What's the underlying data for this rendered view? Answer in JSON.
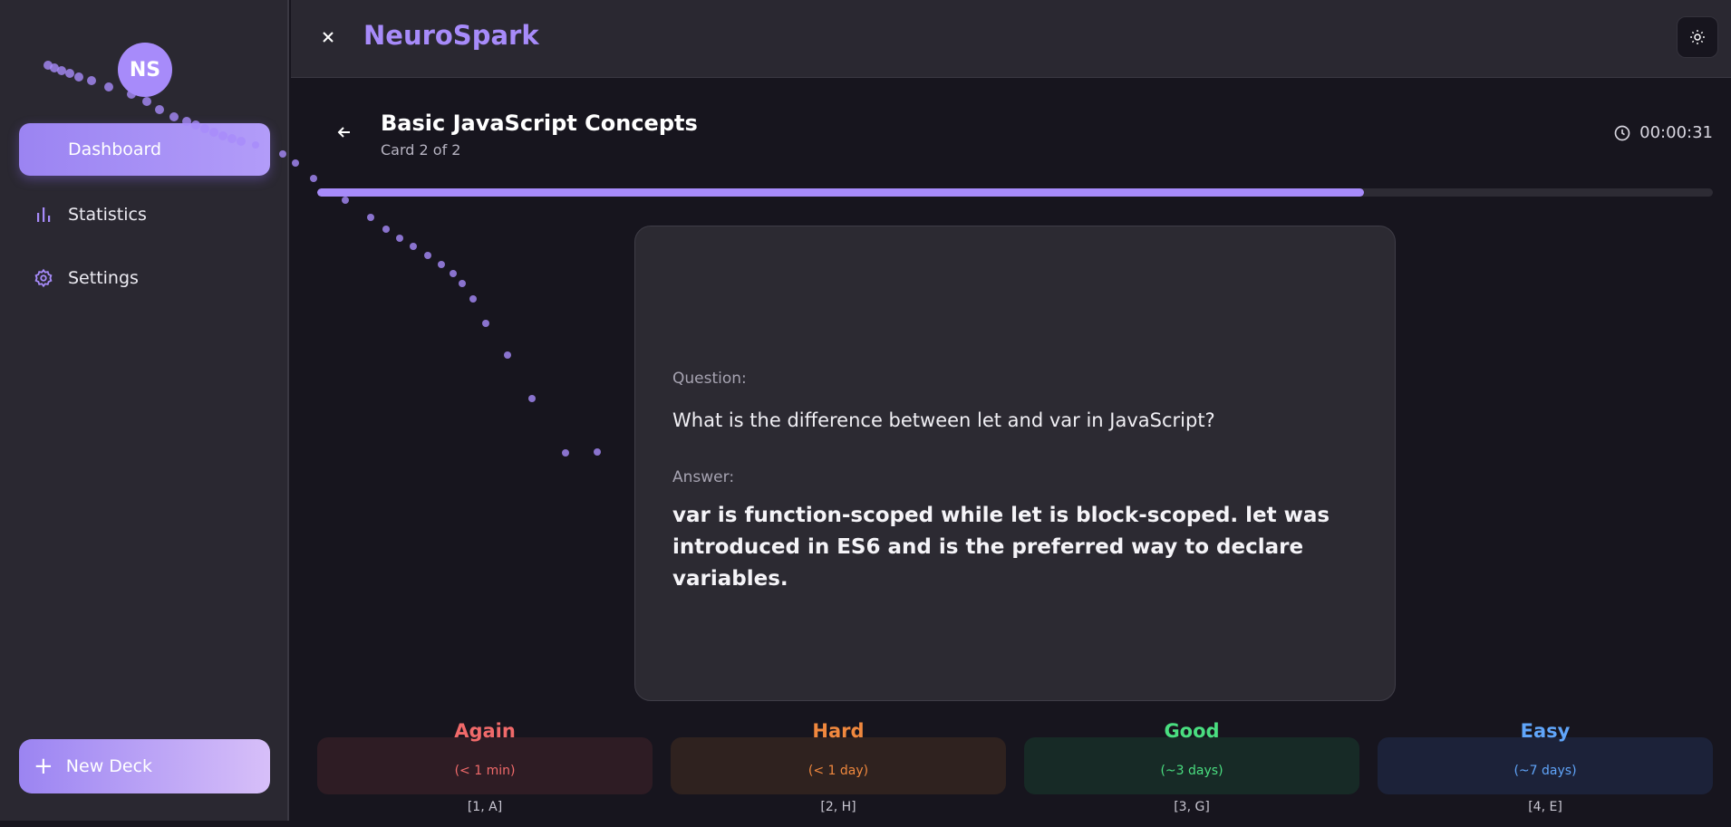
{
  "sidebar": {
    "avatar_initials": "NS",
    "items": [
      {
        "label": "Dashboard",
        "icon": "dashboard"
      },
      {
        "label": "Statistics",
        "icon": "bar-chart-icon"
      },
      {
        "label": "Settings",
        "icon": "gear-icon"
      }
    ],
    "new_deck_label": "New Deck",
    "new_deck_icon": "plus-icon"
  },
  "header": {
    "app_name": "NeuroSpark",
    "close_icon": "close-icon",
    "theme_icon": "sun-icon"
  },
  "study": {
    "deck_title": "Basic JavaScript Concepts",
    "card_position": "Card 2 of 2",
    "timer": "00:00:31",
    "progress": 0.75
  },
  "card": {
    "question_label": "Question:",
    "question": "What is the difference between let and var in JavaScript?",
    "answer_label": "Answer:",
    "answer": "var is function-scoped while let is block-scoped. let was introduced in ES6 and is the preferred way to declare variables."
  },
  "ratings": [
    {
      "label": "Again",
      "interval": "(< 1 min)",
      "keys": "[1, A]",
      "color": "#f06a6a"
    },
    {
      "label": "Hard",
      "interval": "(< 1 day)",
      "keys": "[2, H]",
      "color": "#f0883e"
    },
    {
      "label": "Good",
      "interval": "(~3 days)",
      "keys": "[3, G]",
      "color": "#4ade80"
    },
    {
      "label": "Easy",
      "interval": "(~7 days)",
      "keys": "[4, E]",
      "color": "#60a5fa"
    }
  ],
  "colors": {
    "accent": "#a78bfa",
    "background": "#17151e",
    "panel": "#2a2831"
  }
}
